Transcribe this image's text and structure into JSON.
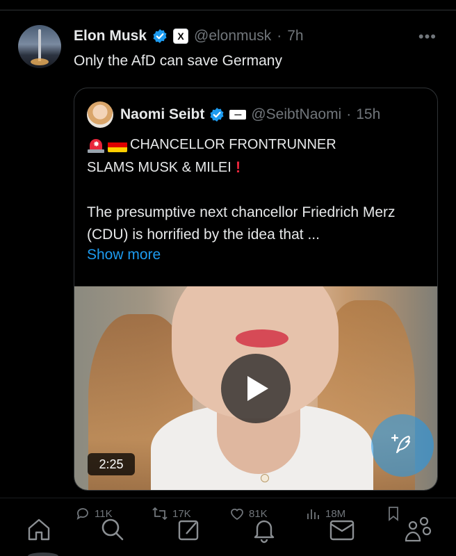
{
  "main_tweet": {
    "display_name": "Elon Musk",
    "affiliation_badge": "X",
    "handle": "@elonmusk",
    "separator": "·",
    "time": "7h",
    "text": "Only the AfD can save Germany",
    "more_icon": "more-horizontal-icon"
  },
  "quoted_tweet": {
    "display_name": "Naomi Seibt",
    "handle": "@SeibtNaomi",
    "separator": "·",
    "time": "15h",
    "headline_line1": "CHANCELLOR FRONTRUNNER",
    "headline_line2": "SLAMS MUSK & MILEI",
    "headline_emphasis": "!",
    "body": "The presumptive next chancellor Friedrich Merz (CDU) is horrified by the idea that ...",
    "show_more": "Show more",
    "video": {
      "duration": "2:25",
      "play_icon": "play-icon"
    }
  },
  "actions": {
    "replies": "11K",
    "reposts": "17K",
    "likes": "81K",
    "views": "18M"
  },
  "nav": {
    "items": [
      "home-icon",
      "search-icon",
      "compose-icon",
      "notifications-icon",
      "messages-icon",
      "communities-icon"
    ]
  },
  "colors": {
    "background": "#000000",
    "text": "#e7e9ea",
    "muted": "#71767b",
    "link": "#1d9bf0",
    "verified": "#1d9bf0",
    "alert_red": "#e8263b"
  }
}
